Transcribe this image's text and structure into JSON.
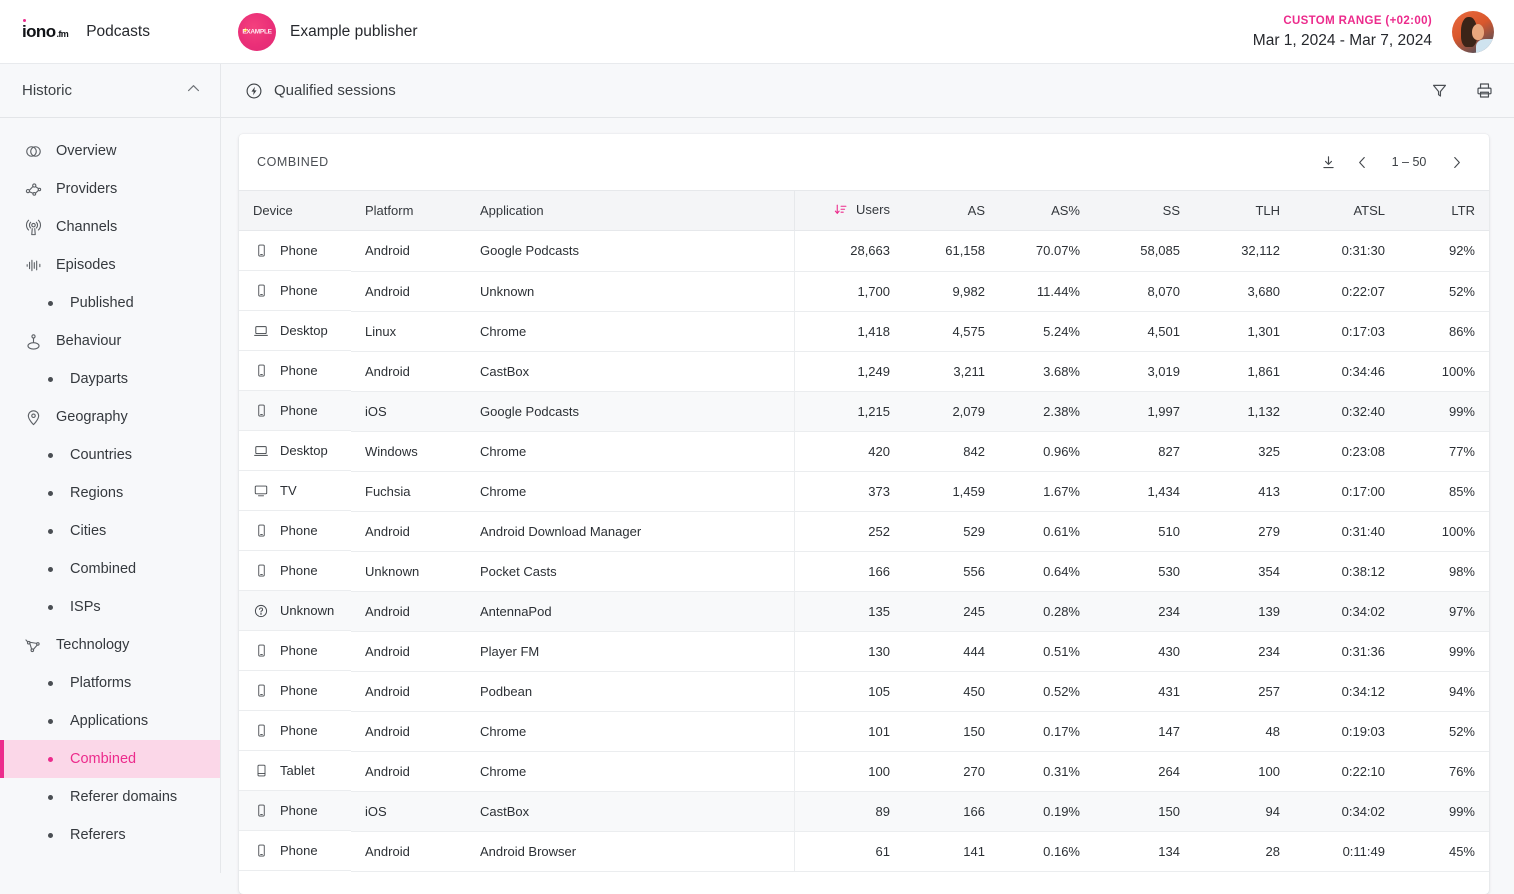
{
  "topbar": {
    "logo_text": "iono",
    "logo_suffix": ".fm",
    "app_title": "Podcasts",
    "publisher_name": "Example publisher",
    "publisher_mark": "EXAMPLE",
    "range_label": "CUSTOM RANGE (+02:00)",
    "range_value": "Mar 1, 2024 - Mar 7, 2024"
  },
  "sidebar": {
    "section_title": "Historic",
    "collapse_icon": "chevron-up-icon",
    "items": [
      {
        "label": "Overview",
        "icon": "overview-venn-icon",
        "sub": false,
        "active": false
      },
      {
        "label": "Providers",
        "icon": "providers-nodes-icon",
        "sub": false,
        "active": false
      },
      {
        "label": "Channels",
        "icon": "channels-podcast-icon",
        "sub": false,
        "active": false
      },
      {
        "label": "Episodes",
        "icon": "episodes-waveform-icon",
        "sub": false,
        "active": false
      },
      {
        "label": "Published",
        "icon": "bullet-icon",
        "sub": true,
        "active": false
      },
      {
        "label": "Behaviour",
        "icon": "behaviour-person-icon",
        "sub": false,
        "active": false
      },
      {
        "label": "Dayparts",
        "icon": "bullet-icon",
        "sub": true,
        "active": false
      },
      {
        "label": "Geography",
        "icon": "map-pin-icon",
        "sub": false,
        "active": false
      },
      {
        "label": "Countries",
        "icon": "bullet-icon",
        "sub": true,
        "active": false
      },
      {
        "label": "Regions",
        "icon": "bullet-icon",
        "sub": true,
        "active": false
      },
      {
        "label": "Cities",
        "icon": "bullet-icon",
        "sub": true,
        "active": false
      },
      {
        "label": "Combined",
        "icon": "bullet-icon",
        "sub": true,
        "active": false
      },
      {
        "label": "ISPs",
        "icon": "bullet-icon",
        "sub": true,
        "active": false
      },
      {
        "label": "Technology",
        "icon": "technology-graph-icon",
        "sub": false,
        "active": false
      },
      {
        "label": "Platforms",
        "icon": "bullet-icon",
        "sub": true,
        "active": false
      },
      {
        "label": "Applications",
        "icon": "bullet-icon",
        "sub": true,
        "active": false
      },
      {
        "label": "Combined",
        "icon": "bullet-icon",
        "sub": true,
        "active": true
      },
      {
        "label": "Referer domains",
        "icon": "bullet-icon",
        "sub": true,
        "active": false
      },
      {
        "label": "Referers",
        "icon": "bullet-icon",
        "sub": true,
        "active": false
      }
    ]
  },
  "page": {
    "title": "Qualified sessions",
    "title_icon": "lightning-circle-icon",
    "filter_icon": "filter-funnel-icon",
    "print_icon": "print-icon"
  },
  "card": {
    "title": "COMBINED",
    "download_icon": "download-icon",
    "prev_icon": "chevron-left-icon",
    "next_icon": "chevron-right-icon",
    "page_range": "1 – 50"
  },
  "table": {
    "sort_icon": "sort-descending-icon",
    "sort_column": "Users",
    "columns": [
      {
        "key": "device",
        "label": "Device",
        "align": "left"
      },
      {
        "key": "platform",
        "label": "Platform",
        "align": "left"
      },
      {
        "key": "app",
        "label": "Application",
        "align": "left"
      },
      {
        "key": "users",
        "label": "Users",
        "align": "right"
      },
      {
        "key": "as",
        "label": "AS",
        "align": "right"
      },
      {
        "key": "asp",
        "label": "AS%",
        "align": "right"
      },
      {
        "key": "ss",
        "label": "SS",
        "align": "right"
      },
      {
        "key": "tlh",
        "label": "TLH",
        "align": "right"
      },
      {
        "key": "atsl",
        "label": "ATSL",
        "align": "right"
      },
      {
        "key": "ltr",
        "label": "LTR",
        "align": "right"
      }
    ],
    "rows": [
      {
        "device": "Phone",
        "device_icon": "phone-icon",
        "platform": "Android",
        "app": "Google Podcasts",
        "users": "28,663",
        "as": "61,158",
        "asp": "70.07%",
        "ss": "58,085",
        "tlh": "32,112",
        "atsl": "0:31:30",
        "ltr": "92%"
      },
      {
        "device": "Phone",
        "device_icon": "phone-icon",
        "platform": "Android",
        "app": "Unknown",
        "users": "1,700",
        "as": "9,982",
        "asp": "11.44%",
        "ss": "8,070",
        "tlh": "3,680",
        "atsl": "0:22:07",
        "ltr": "52%"
      },
      {
        "device": "Desktop",
        "device_icon": "desktop-icon",
        "platform": "Linux",
        "app": "Chrome",
        "users": "1,418",
        "as": "4,575",
        "asp": "5.24%",
        "ss": "4,501",
        "tlh": "1,301",
        "atsl": "0:17:03",
        "ltr": "86%"
      },
      {
        "device": "Phone",
        "device_icon": "phone-icon",
        "platform": "Android",
        "app": "CastBox",
        "users": "1,249",
        "as": "3,211",
        "asp": "3.68%",
        "ss": "3,019",
        "tlh": "1,861",
        "atsl": "0:34:46",
        "ltr": "100%"
      },
      {
        "device": "Phone",
        "device_icon": "phone-icon",
        "platform": "iOS",
        "app": "Google Podcasts",
        "users": "1,215",
        "as": "2,079",
        "asp": "2.38%",
        "ss": "1,997",
        "tlh": "1,132",
        "atsl": "0:32:40",
        "ltr": "99%"
      },
      {
        "device": "Desktop",
        "device_icon": "desktop-icon",
        "platform": "Windows",
        "app": "Chrome",
        "users": "420",
        "as": "842",
        "asp": "0.96%",
        "ss": "827",
        "tlh": "325",
        "atsl": "0:23:08",
        "ltr": "77%"
      },
      {
        "device": "TV",
        "device_icon": "tv-icon",
        "platform": "Fuchsia",
        "app": "Chrome",
        "users": "373",
        "as": "1,459",
        "asp": "1.67%",
        "ss": "1,434",
        "tlh": "413",
        "atsl": "0:17:00",
        "ltr": "85%"
      },
      {
        "device": "Phone",
        "device_icon": "phone-icon",
        "platform": "Android",
        "app": "Android Download Manager",
        "users": "252",
        "as": "529",
        "asp": "0.61%",
        "ss": "510",
        "tlh": "279",
        "atsl": "0:31:40",
        "ltr": "100%"
      },
      {
        "device": "Phone",
        "device_icon": "phone-icon",
        "platform": "Unknown",
        "app": "Pocket Casts",
        "users": "166",
        "as": "556",
        "asp": "0.64%",
        "ss": "530",
        "tlh": "354",
        "atsl": "0:38:12",
        "ltr": "98%"
      },
      {
        "device": "Unknown",
        "device_icon": "unknown-icon",
        "platform": "Android",
        "app": "AntennaPod",
        "users": "135",
        "as": "245",
        "asp": "0.28%",
        "ss": "234",
        "tlh": "139",
        "atsl": "0:34:02",
        "ltr": "97%"
      },
      {
        "device": "Phone",
        "device_icon": "phone-icon",
        "platform": "Android",
        "app": "Player FM",
        "users": "130",
        "as": "444",
        "asp": "0.51%",
        "ss": "430",
        "tlh": "234",
        "atsl": "0:31:36",
        "ltr": "99%"
      },
      {
        "device": "Phone",
        "device_icon": "phone-icon",
        "platform": "Android",
        "app": "Podbean",
        "users": "105",
        "as": "450",
        "asp": "0.52%",
        "ss": "431",
        "tlh": "257",
        "atsl": "0:34:12",
        "ltr": "94%"
      },
      {
        "device": "Phone",
        "device_icon": "phone-icon",
        "platform": "Android",
        "app": "Chrome",
        "users": "101",
        "as": "150",
        "asp": "0.17%",
        "ss": "147",
        "tlh": "48",
        "atsl": "0:19:03",
        "ltr": "52%"
      },
      {
        "device": "Tablet",
        "device_icon": "tablet-icon",
        "platform": "Android",
        "app": "Chrome",
        "users": "100",
        "as": "270",
        "asp": "0.31%",
        "ss": "264",
        "tlh": "100",
        "atsl": "0:22:10",
        "ltr": "76%"
      },
      {
        "device": "Phone",
        "device_icon": "phone-icon",
        "platform": "iOS",
        "app": "CastBox",
        "users": "89",
        "as": "166",
        "asp": "0.19%",
        "ss": "150",
        "tlh": "94",
        "atsl": "0:34:02",
        "ltr": "99%"
      },
      {
        "device": "Phone",
        "device_icon": "phone-icon",
        "platform": "Android",
        "app": "Android Browser",
        "users": "61",
        "as": "141",
        "asp": "0.16%",
        "ss": "134",
        "tlh": "28",
        "atsl": "0:11:49",
        "ltr": "45%"
      }
    ]
  },
  "colors": {
    "accent": "#ec2b8c",
    "accent_bg": "#fbd7e8",
    "page_bg": "#f7f8fa",
    "card_bg": "#ffffff",
    "text": "#2c3035"
  }
}
